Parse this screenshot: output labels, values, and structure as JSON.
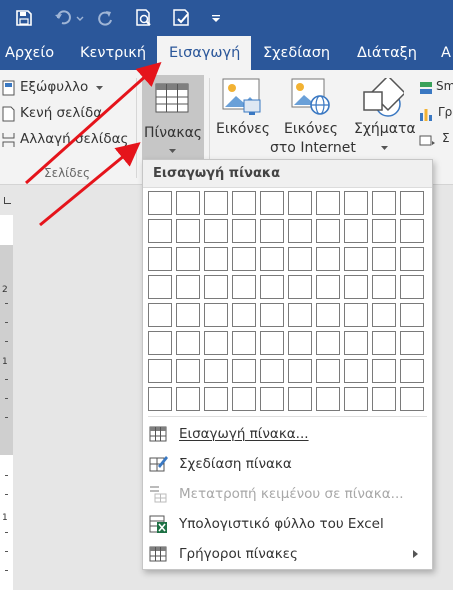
{
  "qat": {
    "icons": [
      "save-icon",
      "undo-icon",
      "redo-icon",
      "print-preview-icon",
      "quick-print-icon",
      "customize-icon"
    ]
  },
  "tabs": [
    "Αρχείο",
    "Κεντρική",
    "Εισαγωγή",
    "Σχεδίαση",
    "Διάταξη",
    "Α"
  ],
  "active_tab": "Εισαγωγή",
  "ribbon": {
    "pages": {
      "cover": "Εξώφυλλο",
      "blank": "Κενή σελίδα",
      "break": "Αλλαγή σελίδας",
      "group_label": "Σελίδες"
    },
    "tables": {
      "label": "Πίνακας"
    },
    "illustrations": {
      "pictures": "Εικόνες",
      "online_line1": "Εικόνες",
      "online_line2": "στο Internet",
      "shapes": "Σχήματα",
      "smartart_partial": "Sm",
      "chart_partial": "Γρ",
      "screenshot_partial": "Σ"
    }
  },
  "ruler": {
    "numbers": [
      "2",
      "1",
      "1"
    ]
  },
  "dropdown": {
    "header": "Εισαγωγή πίνακα",
    "grid": {
      "cols": 10,
      "rows": 8
    },
    "items": [
      {
        "label": "Εισαγωγή πίνακα...",
        "enabled": true
      },
      {
        "label": "Σχεδίαση πίνακα",
        "enabled": true
      },
      {
        "label": "Μετατροπή κειμένου σε πίνακα...",
        "enabled": false
      },
      {
        "label": "Υπολογιστικό φύλλο του Excel",
        "enabled": true
      },
      {
        "label": "Γρήγοροι πίνακες",
        "enabled": true
      }
    ]
  },
  "colors": {
    "title_bar": "#2b579a",
    "annotation_arrow": "#e5141b",
    "ribbon_bg": "#f3f3f3"
  }
}
